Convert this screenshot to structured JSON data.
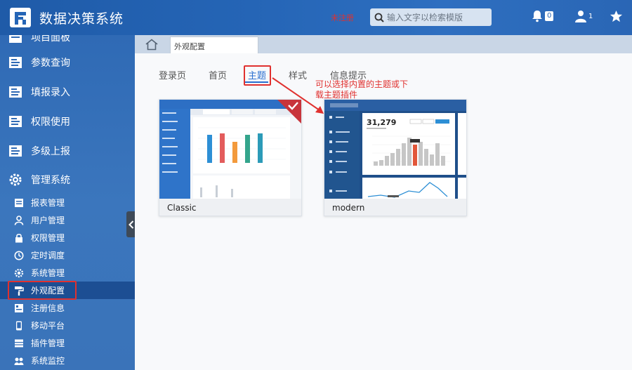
{
  "header": {
    "app_title": "数据决策系统",
    "register_badge": "未注册",
    "search_placeholder": "输入文字以检索模版",
    "notification_count": "0",
    "user_count": "1"
  },
  "sidebar": {
    "items": [
      {
        "label": "项目面板",
        "icon": "dashboard-icon"
      },
      {
        "label": "参数查询",
        "icon": "report-icon"
      },
      {
        "label": "填报录入",
        "icon": "report-icon"
      },
      {
        "label": "权限使用",
        "icon": "report-icon"
      },
      {
        "label": "多级上报",
        "icon": "report-icon"
      },
      {
        "label": "管理系统",
        "icon": "gear-icon"
      }
    ],
    "sub_items": [
      {
        "label": "报表管理",
        "icon": "report-manage-icon"
      },
      {
        "label": "用户管理",
        "icon": "user-icon"
      },
      {
        "label": "权限管理",
        "icon": "lock-icon"
      },
      {
        "label": "定时调度",
        "icon": "clock-icon"
      },
      {
        "label": "系统管理",
        "icon": "gear-icon"
      },
      {
        "label": "外观配置",
        "icon": "paint-roller-icon",
        "active": true
      },
      {
        "label": "注册信息",
        "icon": "register-icon"
      },
      {
        "label": "移动平台",
        "icon": "mobile-icon"
      },
      {
        "label": "插件管理",
        "icon": "plugin-icon"
      },
      {
        "label": "系统监控",
        "icon": "monitor-icon"
      }
    ]
  },
  "tabs": {
    "current_page": "外观配置"
  },
  "subtabs": [
    "登录页",
    "首页",
    "主题",
    "样式",
    "信息提示"
  ],
  "active_subtab": "主题",
  "annotation": "可以选择内置的主题或下载主题插件",
  "themes": [
    {
      "name": "Classic",
      "selected": true
    },
    {
      "name": "modern",
      "selected": false
    }
  ],
  "modern_preview": {
    "big_number": "31,279"
  },
  "colors": {
    "topbar": "#2565b6",
    "sidebar": "#3472b9",
    "accent_blue": "#2a6fd0",
    "highlight_red": "#e0312f"
  }
}
